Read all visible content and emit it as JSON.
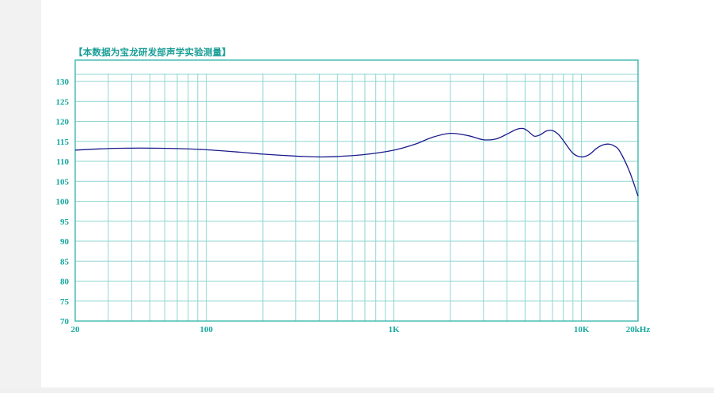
{
  "chart_data": {
    "type": "line",
    "title": "【本数据为宝龙研发部声学实验测量】",
    "xlabel": "",
    "ylabel": "",
    "x_scale": "log",
    "xlim": [
      20,
      20000
    ],
    "ylim": [
      70,
      133
    ],
    "grid": true,
    "y_ticks": [
      70,
      75,
      80,
      85,
      90,
      95,
      100,
      105,
      110,
      115,
      120,
      125,
      130
    ],
    "x_tick_labels": [
      {
        "value": 20,
        "label": "20"
      },
      {
        "value": 100,
        "label": "100"
      },
      {
        "value": 1000,
        "label": "1K"
      },
      {
        "value": 10000,
        "label": "10K"
      },
      {
        "value": 20000,
        "label": "20kHz"
      }
    ],
    "x_gridlines": [
      30,
      40,
      50,
      60,
      70,
      80,
      90,
      100,
      200,
      300,
      400,
      500,
      600,
      700,
      800,
      900,
      1000,
      2000,
      3000,
      4000,
      5000,
      6000,
      7000,
      8000,
      9000,
      10000
    ],
    "series": [
      {
        "name": "",
        "color": "#1a1a8c",
        "x": [
          20,
          30,
          40,
          50,
          70,
          100,
          150,
          200,
          300,
          400,
          500,
          700,
          1000,
          1300,
          1600,
          2000,
          2500,
          3000,
          3500,
          4000,
          4500,
          4900,
          5200,
          5600,
          6000,
          6500,
          7000,
          7500,
          8000,
          9000,
          10000,
          11000,
          12000,
          13000,
          14000,
          15000,
          16000,
          18000,
          20000
        ],
        "values": [
          112.8,
          113.2,
          113.3,
          113.3,
          113.2,
          112.9,
          112.3,
          111.8,
          111.3,
          111.1,
          111.2,
          111.7,
          112.8,
          114.3,
          116.0,
          117.0,
          116.4,
          115.4,
          115.6,
          116.8,
          118.0,
          118.2,
          117.5,
          116.3,
          116.6,
          117.6,
          117.7,
          116.8,
          115.2,
          112.0,
          111.1,
          111.7,
          113.2,
          114.1,
          114.3,
          113.8,
          112.5,
          107.5,
          101.3
        ]
      }
    ]
  },
  "colors": {
    "title": "#1a9e96",
    "grid": "#8fd6d0",
    "frame": "#3db8ae",
    "tick_labels": "#17a89e",
    "curve": "#1a1a8c"
  }
}
